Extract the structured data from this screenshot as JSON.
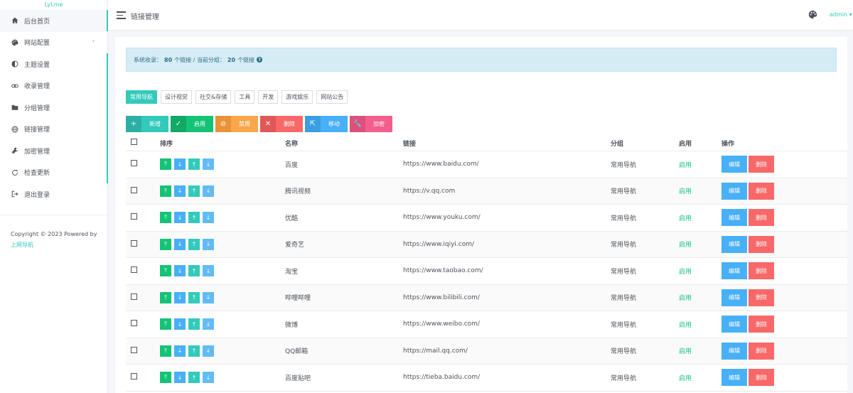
{
  "sidebar": {
    "brand": "LyLme",
    "items": [
      {
        "label": "后台首页",
        "icon": "home-icon"
      },
      {
        "label": "网站配置",
        "icon": "palette-icon",
        "chevron": "›"
      },
      {
        "label": "主题设置",
        "icon": "contrast-icon"
      },
      {
        "label": "收录管理",
        "icon": "link-icon"
      },
      {
        "label": "分组管理",
        "icon": "folder-icon"
      },
      {
        "label": "链接管理",
        "icon": "globe-icon"
      },
      {
        "label": "加密管理",
        "icon": "wrench-icon"
      },
      {
        "label": "检查更新",
        "icon": "refresh-icon"
      },
      {
        "label": "退出登录",
        "icon": "logout-icon"
      }
    ],
    "copyright_text": "Copyright © 2023 Powered by",
    "copyright_link": "上网导航"
  },
  "topbar": {
    "title": "链接管理",
    "user": "admin"
  },
  "alert": {
    "prefix": "系统收录：",
    "total": "80",
    "mid": "个链接 / 当前分组：",
    "group_count": "20",
    "suffix": "个链接",
    "help": "?"
  },
  "tabs": [
    "常用导航",
    "设计视觉",
    "社交&存储",
    "工具",
    "开发",
    "游戏娱乐",
    "网站公告"
  ],
  "actions": [
    {
      "label": "新增",
      "icon": "+",
      "color": "#33cabb",
      "shade": "#2bb0a3",
      "width": 60
    },
    {
      "label": "启用",
      "icon": "✓",
      "color": "#15c377",
      "shade": "#12a866",
      "width": 60
    },
    {
      "label": "禁用",
      "icon": "⊘",
      "color": "#faa64b",
      "shade": "#e89239",
      "width": 60
    },
    {
      "label": "删除",
      "icon": "✕",
      "color": "#f96868",
      "shade": "#e25757",
      "width": 60
    },
    {
      "label": "移动",
      "icon": "⇱",
      "color": "#48b0f7",
      "shade": "#3a9ee2",
      "width": 60
    },
    {
      "label": "加密",
      "icon": "🔧",
      "color": "#f35e8d",
      "shade": "#de4f7c",
      "width": 60
    }
  ],
  "table": {
    "headers": {
      "sort": "排序",
      "name": "名称",
      "url": "链接",
      "group": "分组",
      "enabled": "启用",
      "ops": "操作"
    },
    "sort_icons": [
      "⤒",
      "↓",
      "↑",
      "↓"
    ],
    "edit_label": "编辑",
    "delete_label": "删除",
    "rows": [
      {
        "name": "百度",
        "url": "https://www.baidu.com/",
        "group": "常用导航",
        "enabled": "启用"
      },
      {
        "name": "腾讯视频",
        "url": "https://v.qq.com",
        "group": "常用导航",
        "enabled": "启用"
      },
      {
        "name": "优酷",
        "url": "https://www.youku.com/",
        "group": "常用导航",
        "enabled": "启用"
      },
      {
        "name": "爱奇艺",
        "url": "https://www.iqiyi.com/",
        "group": "常用导航",
        "enabled": "启用"
      },
      {
        "name": "淘宝",
        "url": "https://www.taobao.com/",
        "group": "常用导航",
        "enabled": "启用"
      },
      {
        "name": "哔哩哔哩",
        "url": "https://www.bilibili.com/",
        "group": "常用导航",
        "enabled": "启用"
      },
      {
        "name": "微博",
        "url": "https://www.weibo.com/",
        "group": "常用导航",
        "enabled": "启用"
      },
      {
        "name": "QQ邮箱",
        "url": "https://mail.qq.com/",
        "group": "常用导航",
        "enabled": "启用"
      },
      {
        "name": "百度贴吧",
        "url": "https://tieba.baidu.com/",
        "group": "常用导航",
        "enabled": "启用"
      }
    ]
  }
}
